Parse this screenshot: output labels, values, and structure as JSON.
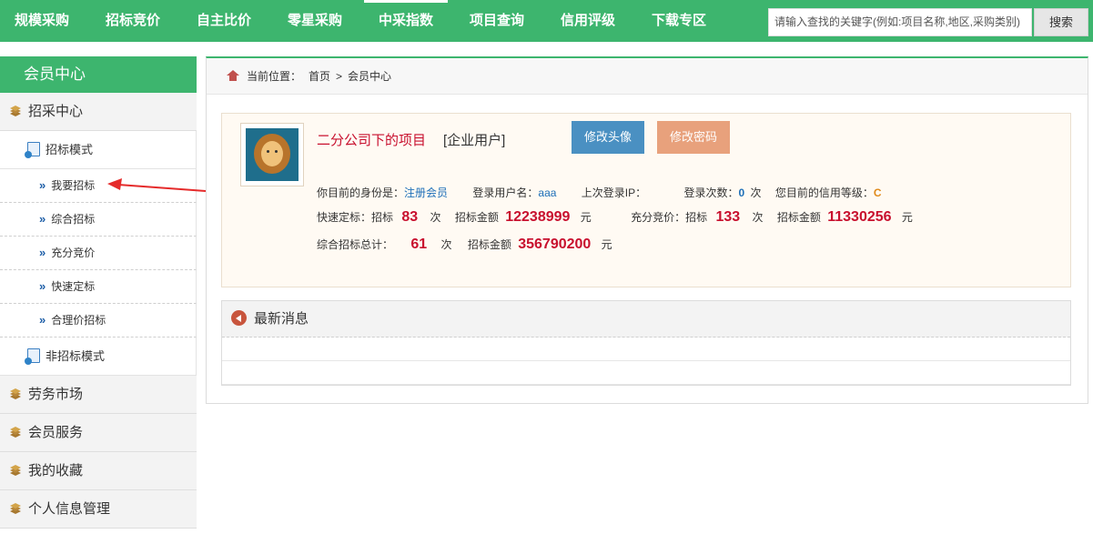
{
  "topnav": {
    "items": [
      {
        "label": "规模采购"
      },
      {
        "label": "招标竞价"
      },
      {
        "label": "自主比价"
      },
      {
        "label": "零星采购"
      },
      {
        "label": "中采指数"
      },
      {
        "label": "项目查询"
      },
      {
        "label": "信用评级"
      },
      {
        "label": "下载专区"
      }
    ],
    "search_placeholder": "请输入查找的关键字(例如:项目名称,地区,采购类别)",
    "search_button": "搜索"
  },
  "sidebar": {
    "header": "会员中心",
    "cat_zhaocai": "招采中心",
    "sub_zhaobiao": "招标模式",
    "leaves": [
      {
        "label": "我要招标"
      },
      {
        "label": "综合招标"
      },
      {
        "label": "充分竞价"
      },
      {
        "label": "快速定标"
      },
      {
        "label": "合理价招标"
      }
    ],
    "sub_fei": "非招标模式",
    "cats": [
      {
        "label": "劳务市场"
      },
      {
        "label": "会员服务"
      },
      {
        "label": "我的收藏"
      },
      {
        "label": "个人信息管理"
      }
    ]
  },
  "breadcrumb": {
    "prefix": "当前位置：",
    "home": "首页",
    "sep": ">",
    "current": "会员中心"
  },
  "profile": {
    "name": "二分公司下的项目",
    "role": "[企业用户]",
    "btn_avatar": "修改头像",
    "btn_password": "修改密码",
    "identity_label": "你目前的身份是：",
    "identity_value": "注册会员",
    "username_label": "登录用户名：",
    "username_value": "aaa",
    "last_ip_label": "上次登录IP：",
    "login_count_label": "登录次数：",
    "login_count_value": "0",
    "login_count_unit": "次",
    "credit_label": "您目前的信用等级：",
    "credit_value": "C"
  },
  "stats": {
    "fast_label": "快速定标：招标",
    "fast_count": "83",
    "unit_ci": "次",
    "amount_label": "招标金额",
    "fast_amount": "12238999",
    "unit_yuan": "元",
    "compete_label": "充分竞价：招标",
    "compete_count": "133",
    "compete_amount": "11330256",
    "total_label": "综合招标总计：",
    "total_count": "61",
    "total_amount": "356790200"
  },
  "news": {
    "title": "最新消息"
  }
}
